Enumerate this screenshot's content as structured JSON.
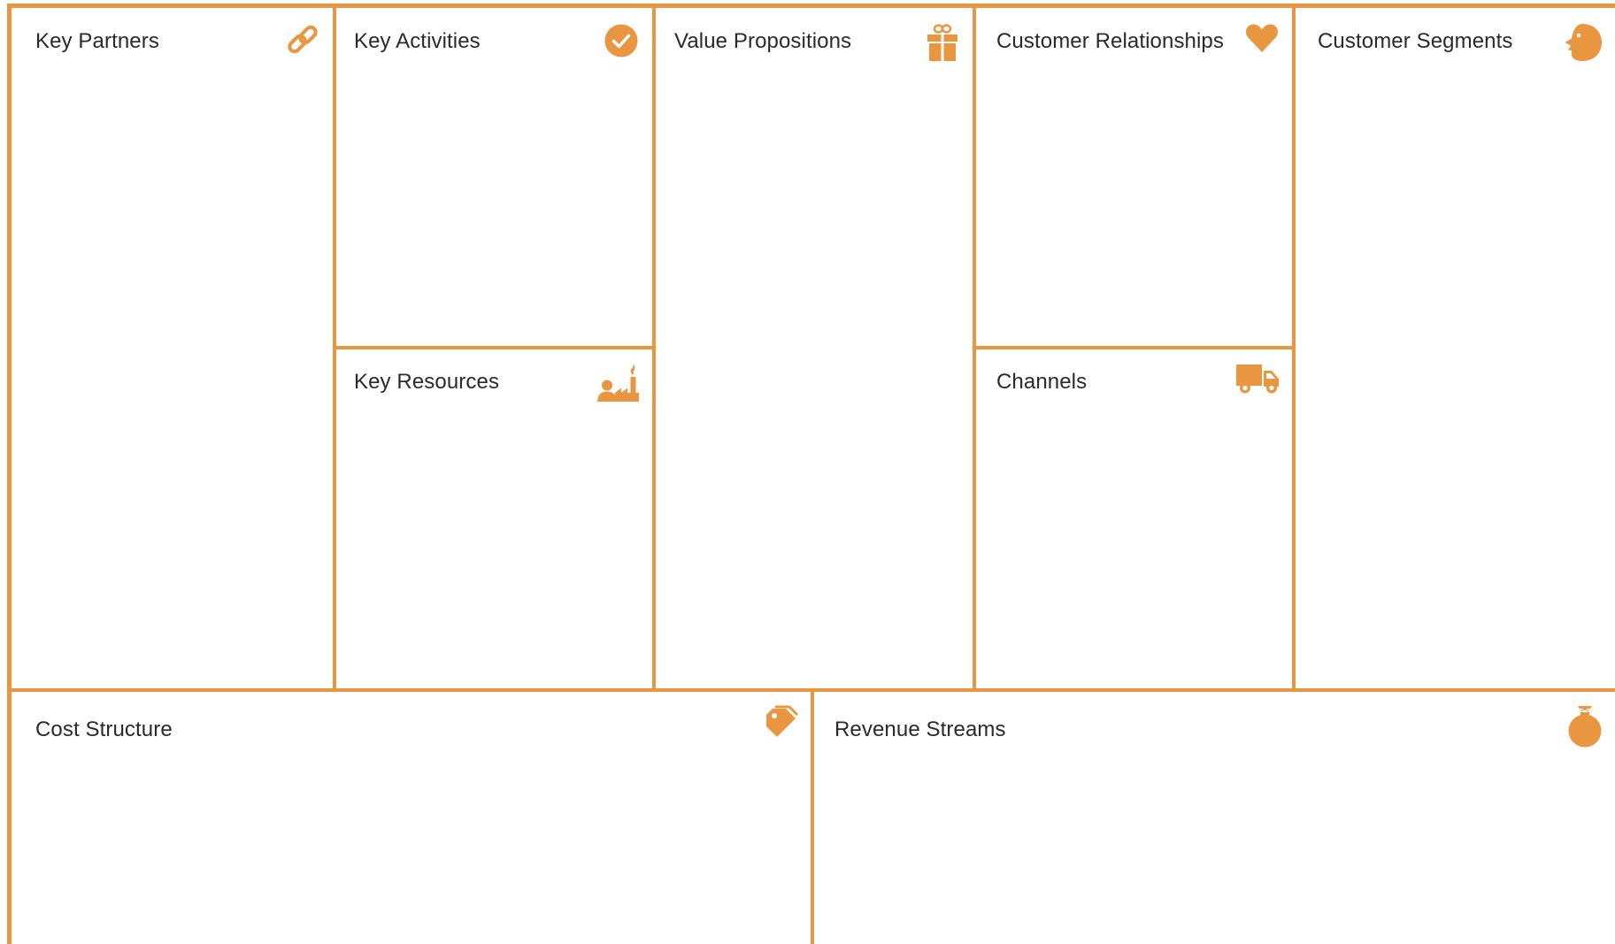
{
  "colors": {
    "accent": "#e8963f",
    "text": "#2a2a2a",
    "background": "#ffffff"
  },
  "blocks": {
    "key_partners": {
      "title": "Key Partners",
      "icon": "link-icon"
    },
    "key_activities": {
      "title": "Key Activities",
      "icon": "checkmark-circle-icon"
    },
    "key_resources": {
      "title": "Key Resources",
      "icon": "worker-factory-icon"
    },
    "value_propositions": {
      "title": "Value Propositions",
      "icon": "gift-icon"
    },
    "customer_relationships": {
      "title": "Customer Relationships",
      "icon": "heart-icon"
    },
    "channels": {
      "title": "Channels",
      "icon": "delivery-truck-icon"
    },
    "customer_segments": {
      "title": "Customer Segments",
      "icon": "face-profile-icon"
    },
    "cost_structure": {
      "title": "Cost Structure",
      "icon": "price-tag-icon"
    },
    "revenue_streams": {
      "title": "Revenue Streams",
      "icon": "money-bag-icon"
    }
  }
}
